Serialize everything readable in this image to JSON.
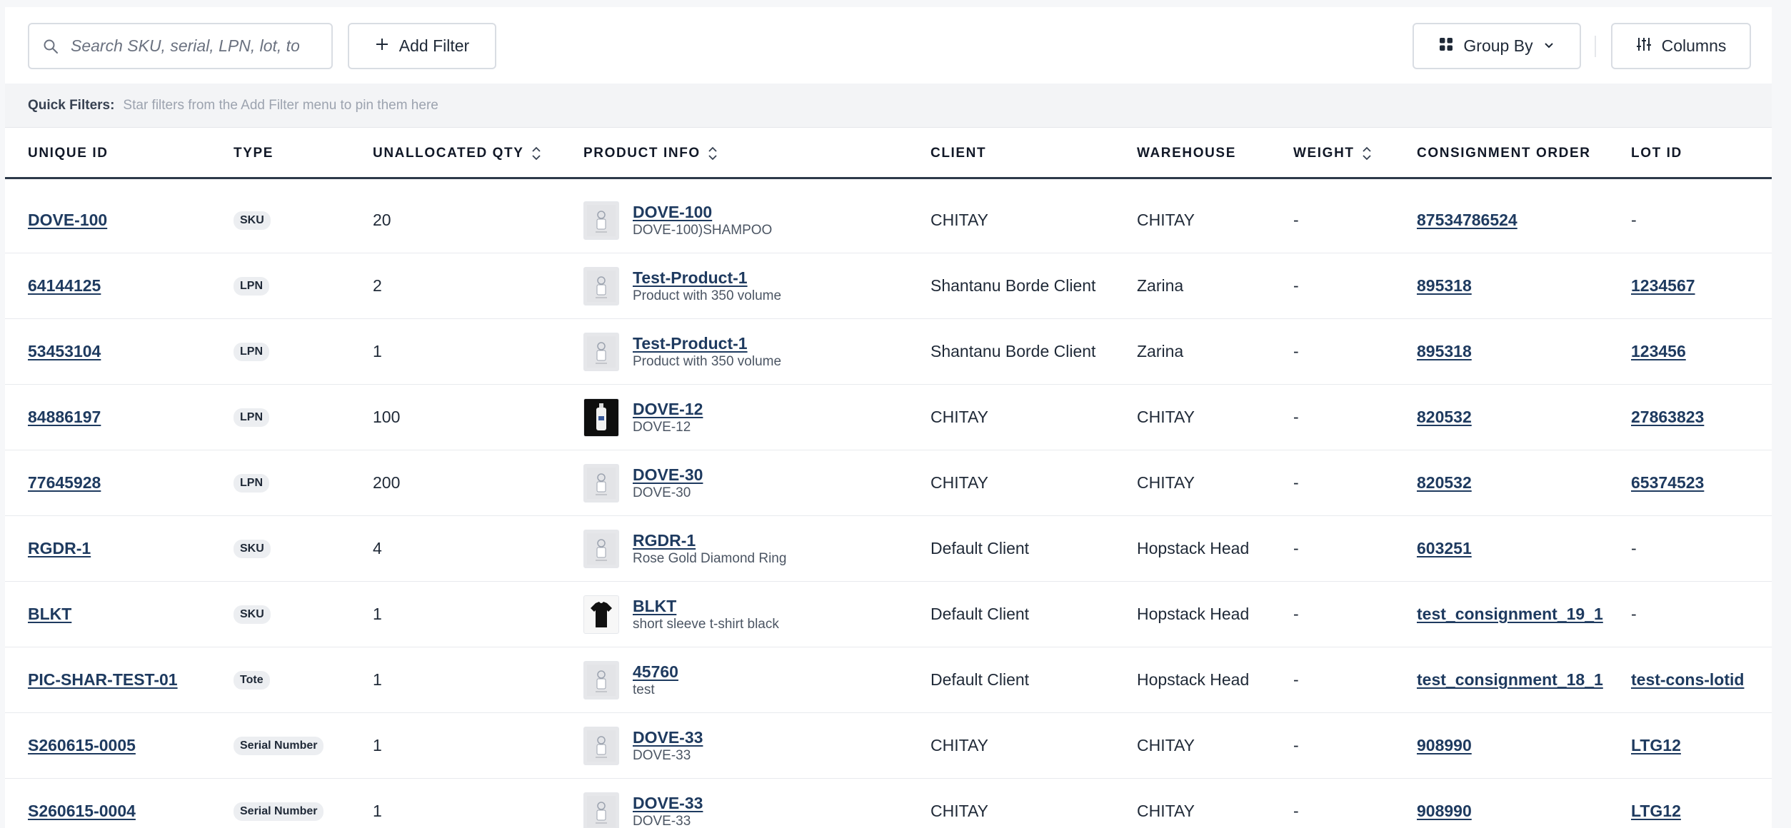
{
  "toolbar": {
    "search_placeholder": "Search SKU, serial, LPN, lot, tote",
    "add_filter_label": "Add Filter",
    "group_by_label": "Group By",
    "columns_label": "Columns"
  },
  "quick_filters": {
    "label": "Quick Filters:",
    "hint": "Star filters from the Add Filter menu to pin them here"
  },
  "columns": [
    {
      "label": "UNIQUE ID",
      "sortable": false
    },
    {
      "label": "TYPE",
      "sortable": false
    },
    {
      "label": "UNALLOCATED QTY",
      "sortable": true
    },
    {
      "label": "PRODUCT INFO",
      "sortable": true
    },
    {
      "label": "CLIENT",
      "sortable": false
    },
    {
      "label": "WAREHOUSE",
      "sortable": false
    },
    {
      "label": "WEIGHT",
      "sortable": true
    },
    {
      "label": "CONSIGNMENT ORDER",
      "sortable": false
    },
    {
      "label": "LOT ID",
      "sortable": false
    }
  ],
  "rows": [
    {
      "unique_id": "DOVE-100",
      "type": "SKU",
      "qty": "20",
      "product_name": "DOVE-100",
      "product_desc": "DOVE-100)SHAMPOO",
      "thumb": "placeholder",
      "client": "CHITAY",
      "warehouse": "CHITAY",
      "weight": "-",
      "consignment": "87534786524",
      "lot_id": "-"
    },
    {
      "unique_id": "64144125",
      "type": "LPN",
      "qty": "2",
      "product_name": "Test-Product-1",
      "product_desc": "Product with 350 volume",
      "thumb": "placeholder",
      "client": "Shantanu Borde Client",
      "warehouse": "Zarina",
      "weight": "-",
      "consignment": "895318",
      "lot_id": "1234567"
    },
    {
      "unique_id": "53453104",
      "type": "LPN",
      "qty": "1",
      "product_name": "Test-Product-1",
      "product_desc": "Product with 350 volume",
      "thumb": "placeholder",
      "client": "Shantanu Borde Client",
      "warehouse": "Zarina",
      "weight": "-",
      "consignment": "895318",
      "lot_id": "123456"
    },
    {
      "unique_id": "84886197",
      "type": "LPN",
      "qty": "100",
      "product_name": "DOVE-12",
      "product_desc": "DOVE-12",
      "thumb": "bottle",
      "client": "CHITAY",
      "warehouse": "CHITAY",
      "weight": "-",
      "consignment": "820532",
      "lot_id": "27863823"
    },
    {
      "unique_id": "77645928",
      "type": "LPN",
      "qty": "200",
      "product_name": "DOVE-30",
      "product_desc": "DOVE-30",
      "thumb": "placeholder",
      "client": "CHITAY",
      "warehouse": "CHITAY",
      "weight": "-",
      "consignment": "820532",
      "lot_id": "65374523"
    },
    {
      "unique_id": "RGDR-1",
      "type": "SKU",
      "qty": "4",
      "product_name": "RGDR-1",
      "product_desc": "Rose Gold Diamond Ring",
      "thumb": "placeholder",
      "client": "Default Client",
      "warehouse": "Hopstack Head",
      "weight": "-",
      "consignment": "603251",
      "lot_id": "-"
    },
    {
      "unique_id": "BLKT",
      "type": "SKU",
      "qty": "1",
      "product_name": "BLKT",
      "product_desc": "short sleeve t-shirt black",
      "thumb": "tshirt",
      "client": "Default Client",
      "warehouse": "Hopstack Head",
      "weight": "-",
      "consignment": "test_consignment_19_1",
      "lot_id": "-"
    },
    {
      "unique_id": "PIC-SHAR-TEST-01",
      "type": "Tote",
      "qty": "1",
      "product_name": "45760",
      "product_desc": "test",
      "thumb": "placeholder",
      "client": "Default Client",
      "warehouse": "Hopstack Head",
      "weight": "-",
      "consignment": "test_consignment_18_1",
      "lot_id": "test-cons-lotid"
    },
    {
      "unique_id": "S260615-0005",
      "type": "Serial Number",
      "qty": "1",
      "product_name": "DOVE-33",
      "product_desc": "DOVE-33",
      "thumb": "placeholder",
      "client": "CHITAY",
      "warehouse": "CHITAY",
      "weight": "-",
      "consignment": "908990",
      "lot_id": "LTG12"
    },
    {
      "unique_id": "S260615-0004",
      "type": "Serial Number",
      "qty": "1",
      "product_name": "DOVE-33",
      "product_desc": "DOVE-33",
      "thumb": "placeholder",
      "client": "CHITAY",
      "warehouse": "CHITAY",
      "weight": "-",
      "consignment": "908990",
      "lot_id": "LTG12"
    }
  ]
}
